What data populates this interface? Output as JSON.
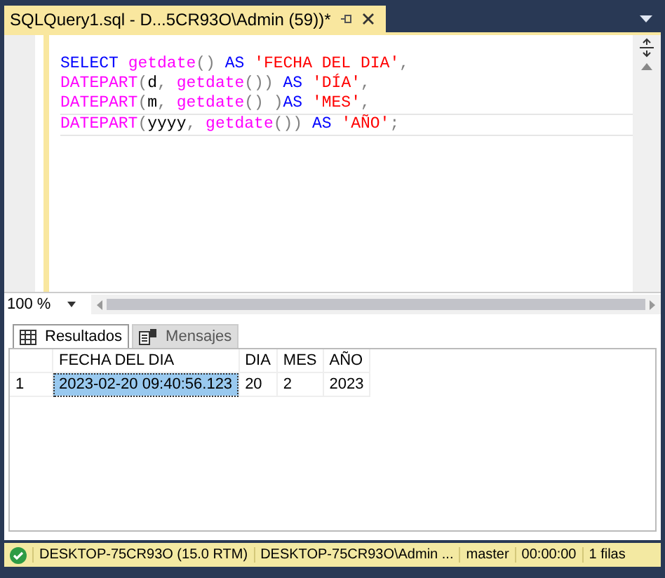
{
  "document_tab": {
    "title": "SQLQuery1.sql - D...5CR93O\\Admin (59))*",
    "selected": true
  },
  "editor": {
    "lines": [
      [
        {
          "kind": "keyword",
          "text": "SELECT"
        },
        {
          "kind": "function",
          "text": " getdate"
        },
        {
          "kind": "gray",
          "text": "()"
        },
        {
          "kind": "keyword",
          "text": " AS"
        },
        {
          "kind": "string",
          "text": " 'FECHA DEL DIA'"
        },
        {
          "kind": "gray",
          "text": ","
        }
      ],
      [
        {
          "kind": "function",
          "text": "DATEPART"
        },
        {
          "kind": "gray",
          "text": "("
        },
        {
          "kind": "plain",
          "text": "d"
        },
        {
          "kind": "gray",
          "text": ","
        },
        {
          "kind": "function",
          "text": " getdate"
        },
        {
          "kind": "gray",
          "text": "())"
        },
        {
          "kind": "keyword",
          "text": " AS"
        },
        {
          "kind": "string",
          "text": " 'DÍA'"
        },
        {
          "kind": "gray",
          "text": ","
        }
      ],
      [
        {
          "kind": "function",
          "text": "DATEPART"
        },
        {
          "kind": "gray",
          "text": "("
        },
        {
          "kind": "plain",
          "text": "m"
        },
        {
          "kind": "gray",
          "text": ","
        },
        {
          "kind": "function",
          "text": " getdate"
        },
        {
          "kind": "gray",
          "text": "() )"
        },
        {
          "kind": "keyword",
          "text": "AS"
        },
        {
          "kind": "string",
          "text": " 'MES'"
        },
        {
          "kind": "gray",
          "text": ","
        }
      ],
      [
        {
          "kind": "function",
          "text": "DATEPART"
        },
        {
          "kind": "gray",
          "text": "("
        },
        {
          "kind": "plain",
          "text": "yyyy"
        },
        {
          "kind": "gray",
          "text": ","
        },
        {
          "kind": "function",
          "text": " getdate"
        },
        {
          "kind": "gray",
          "text": "())"
        },
        {
          "kind": "keyword",
          "text": " AS"
        },
        {
          "kind": "string",
          "text": " 'AÑO'"
        },
        {
          "kind": "gray",
          "text": ";"
        }
      ]
    ]
  },
  "zoom": {
    "value": "100 %"
  },
  "result_tabs": [
    {
      "label": "Resultados",
      "selected": true
    },
    {
      "label": "Mensajes",
      "selected": false
    }
  ],
  "grid": {
    "columns": [
      "FECHA DEL DIA",
      "DIA",
      "MES",
      "AÑO"
    ],
    "rows": [
      {
        "number": "1",
        "cells": [
          {
            "text": "2023-02-20 09:40:56.123",
            "selected": true
          },
          {
            "text": "20",
            "selected": false
          },
          {
            "text": "2",
            "selected": false
          },
          {
            "text": "2023",
            "selected": false
          }
        ]
      }
    ]
  },
  "status_bar": [
    "DESKTOP-75CR93O (15.0 RTM)",
    "DESKTOP-75CR93O\\Admin ...",
    "master",
    "00:00:00",
    "1 filas"
  ]
}
